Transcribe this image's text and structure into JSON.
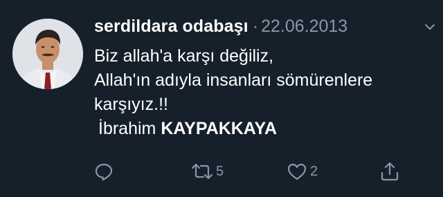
{
  "tweet": {
    "author_name": "serdildara odabaşı",
    "separator": "·",
    "date": "22.06.2013",
    "lines": [
      "Biz allah'a karşı değiliz,",
      "Allah'ın adıyla insanları sömürenlere",
      "karşıyız.!!"
    ],
    "signature_first": "İbrahim",
    "signature_last": "KAYPAKKAYA"
  },
  "actions": {
    "reply_icon": "reply-icon",
    "retweet_icon": "retweet-icon",
    "retweet_count": "5",
    "like_icon": "heart-icon",
    "like_count": "2",
    "share_icon": "share-icon"
  },
  "colors": {
    "background": "#15202b",
    "text": "#ffffff",
    "muted": "#8899a6"
  }
}
